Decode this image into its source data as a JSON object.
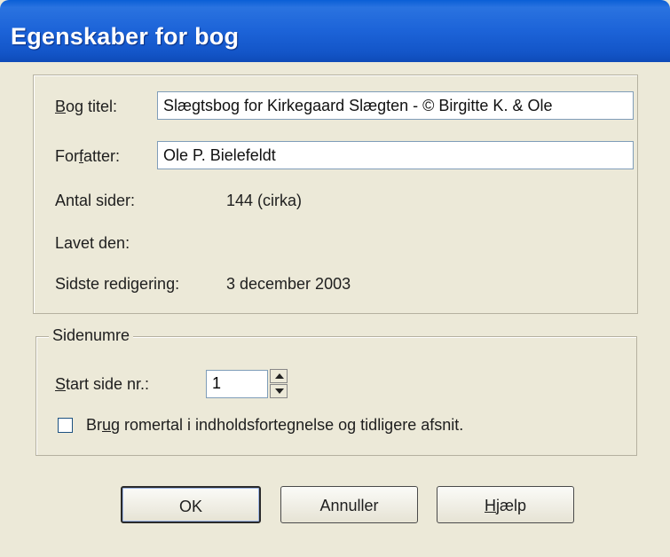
{
  "window": {
    "title": "Egenskaber for bog"
  },
  "properties": {
    "book_title_label_pre": "",
    "book_title_label_u": "B",
    "book_title_label_post": "og titel:",
    "book_title_value": "Slægtsbog for Kirkegaard Slægten - © Birgitte K. & Ole",
    "author_label_pre": "For",
    "author_label_u": "f",
    "author_label_post": "atter:",
    "author_value": "Ole P. Bielefeldt",
    "pages_label": "Antal sider:",
    "pages_value": "144 (cirka)",
    "created_label": "Lavet den:",
    "created_value": "",
    "last_edit_label": "Sidste redigering:",
    "last_edit_value": "3 december 2003"
  },
  "page_numbers": {
    "group_label": "Sidenumre",
    "start_label_u": "S",
    "start_label_post": "tart side nr.:",
    "start_value": "1",
    "roman_checked": false,
    "roman_label_pre": "Br",
    "roman_label_u": "u",
    "roman_label_post": "g romertal i indholdsfortegnelse og tidligere afsnit."
  },
  "buttons": {
    "ok": "OK",
    "cancel": "Annuller",
    "help_u": "H",
    "help_post": "jælp"
  }
}
